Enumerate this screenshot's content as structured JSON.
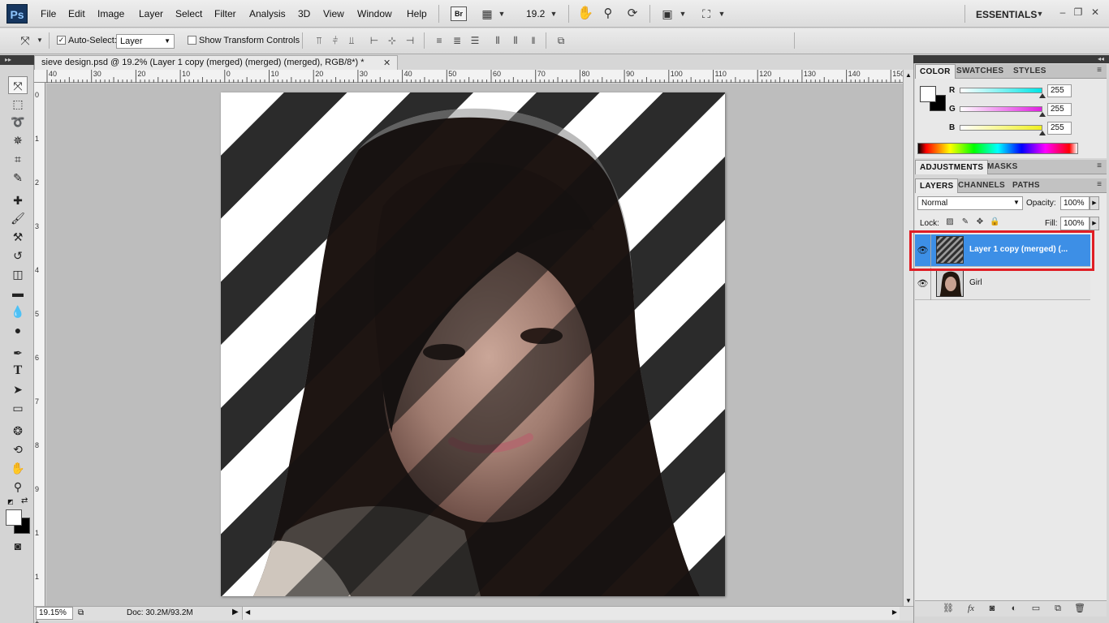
{
  "app": {
    "logo": "Ps",
    "menu": [
      "File",
      "Edit",
      "Image",
      "Layer",
      "Select",
      "Filter",
      "Analysis",
      "3D",
      "View",
      "Window",
      "Help"
    ],
    "bridge_badge": "Br",
    "zoom_field": "19.2",
    "workspace": "ESSENTIALS",
    "window_controls": [
      "–",
      "❐",
      "✕"
    ]
  },
  "options": {
    "auto_select_label": "Auto-Select:",
    "auto_select_checked": "✓",
    "auto_select_value": "Layer",
    "show_transform_label": "Show Transform Controls"
  },
  "document": {
    "tab_title": "sieve design.psd @ 19.2% (Layer 1 copy (merged) (merged) (merged), RGB/8*) *",
    "tab_close": "✕",
    "ruler_top": [
      "40",
      "30",
      "20",
      "10",
      "0",
      "10",
      "20",
      "30",
      "40",
      "50",
      "60",
      "70",
      "80",
      "90",
      "100",
      "110",
      "120",
      "130",
      "140",
      "150"
    ],
    "ruler_left": [
      "0",
      "1",
      "2",
      "3",
      "4",
      "5",
      "6",
      "7",
      "8",
      "9",
      "1",
      "1",
      "1"
    ],
    "zoom_percent": "19.15%",
    "doc_size": "Doc: 30.2M/93.2M"
  },
  "color_panel": {
    "tabs": [
      "COLOR",
      "SWATCHES",
      "STYLES"
    ],
    "channels": [
      {
        "label": "R",
        "value": "255",
        "fraction": 1.0,
        "color": "#00e5e5"
      },
      {
        "label": "G",
        "value": "255",
        "fraction": 1.0,
        "color": "#e020e0"
      },
      {
        "label": "B",
        "value": "255",
        "fraction": 1.0,
        "color": "#f0f020"
      }
    ],
    "foreground": "#ffffff",
    "background": "#000000"
  },
  "adjustments_panel": {
    "tabs": [
      "ADJUSTMENTS",
      "MASKS"
    ]
  },
  "layers_panel": {
    "tabs": [
      "LAYERS",
      "CHANNELS",
      "PATHS"
    ],
    "blend_mode": "Normal",
    "opacity_label": "Opacity:",
    "opacity_value": "100%",
    "lock_label": "Lock:",
    "fill_label": "Fill:",
    "fill_value": "100%",
    "layers": [
      {
        "name": "Layer 1 copy (merged) (...",
        "selected": true
      },
      {
        "name": "Girl",
        "selected": false
      }
    ]
  },
  "colors": {
    "selection_blue": "#3d8fe6",
    "highlight_red": "#e01e25"
  }
}
